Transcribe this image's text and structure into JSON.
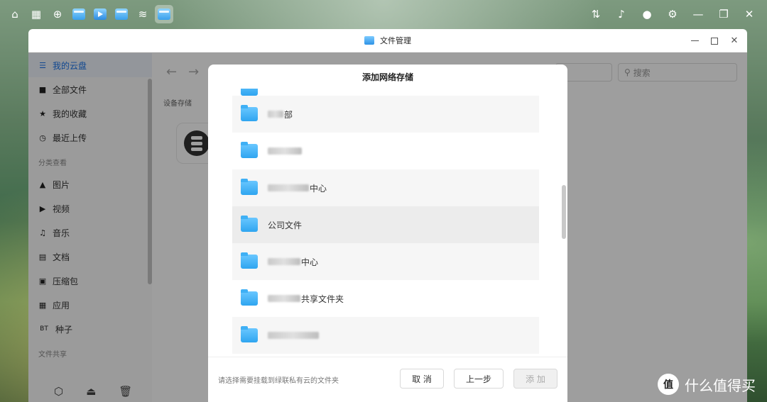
{
  "taskbar": {
    "left_icons": [
      "home-icon",
      "apps-grid-icon",
      "globe-icon",
      "file-app-icon",
      "video-app-icon",
      "file-app-icon",
      "wifi-app-icon",
      "file-manager-app-icon"
    ],
    "right_icons": [
      "transfer-icon",
      "bell-icon",
      "user-icon",
      "settings-icon"
    ]
  },
  "window": {
    "title": "文件管理"
  },
  "sidebar": {
    "items": [
      {
        "label": "我的云盘",
        "icon": "cloud-drive-icon"
      },
      {
        "label": "全部文件",
        "icon": "file-icon"
      },
      {
        "label": "我的收藏",
        "icon": "star-icon"
      },
      {
        "label": "最近上传",
        "icon": "clock-icon"
      }
    ],
    "section_category": "分类查看",
    "categories": [
      {
        "label": "图片",
        "icon": "image-icon"
      },
      {
        "label": "视频",
        "icon": "video-icon"
      },
      {
        "label": "音乐",
        "icon": "headphones-icon"
      },
      {
        "label": "文档",
        "icon": "document-icon"
      },
      {
        "label": "压缩包",
        "icon": "archive-icon"
      },
      {
        "label": "应用",
        "icon": "apps-icon"
      },
      {
        "label": "种子",
        "icon": "bt-icon",
        "prefix": "BT"
      }
    ],
    "section_share": "文件共享"
  },
  "content": {
    "search_placeholder": "搜索",
    "device_label": "设备存储"
  },
  "dialog": {
    "title": "添加网络存储",
    "folders": [
      {
        "suffix": "部"
      },
      {
        "suffix": ""
      },
      {
        "suffix": "中心"
      },
      {
        "suffix": "公司文件"
      },
      {
        "suffix": "中心"
      },
      {
        "suffix": "共享文件夹"
      },
      {
        "suffix": ""
      }
    ],
    "hint": "请选择需要挂载到绿联私有云的文件夹",
    "buttons": {
      "cancel": "取 消",
      "prev": "上一步",
      "add": "添 加"
    }
  },
  "watermark": {
    "logo": "值",
    "text": "什么值得买"
  }
}
